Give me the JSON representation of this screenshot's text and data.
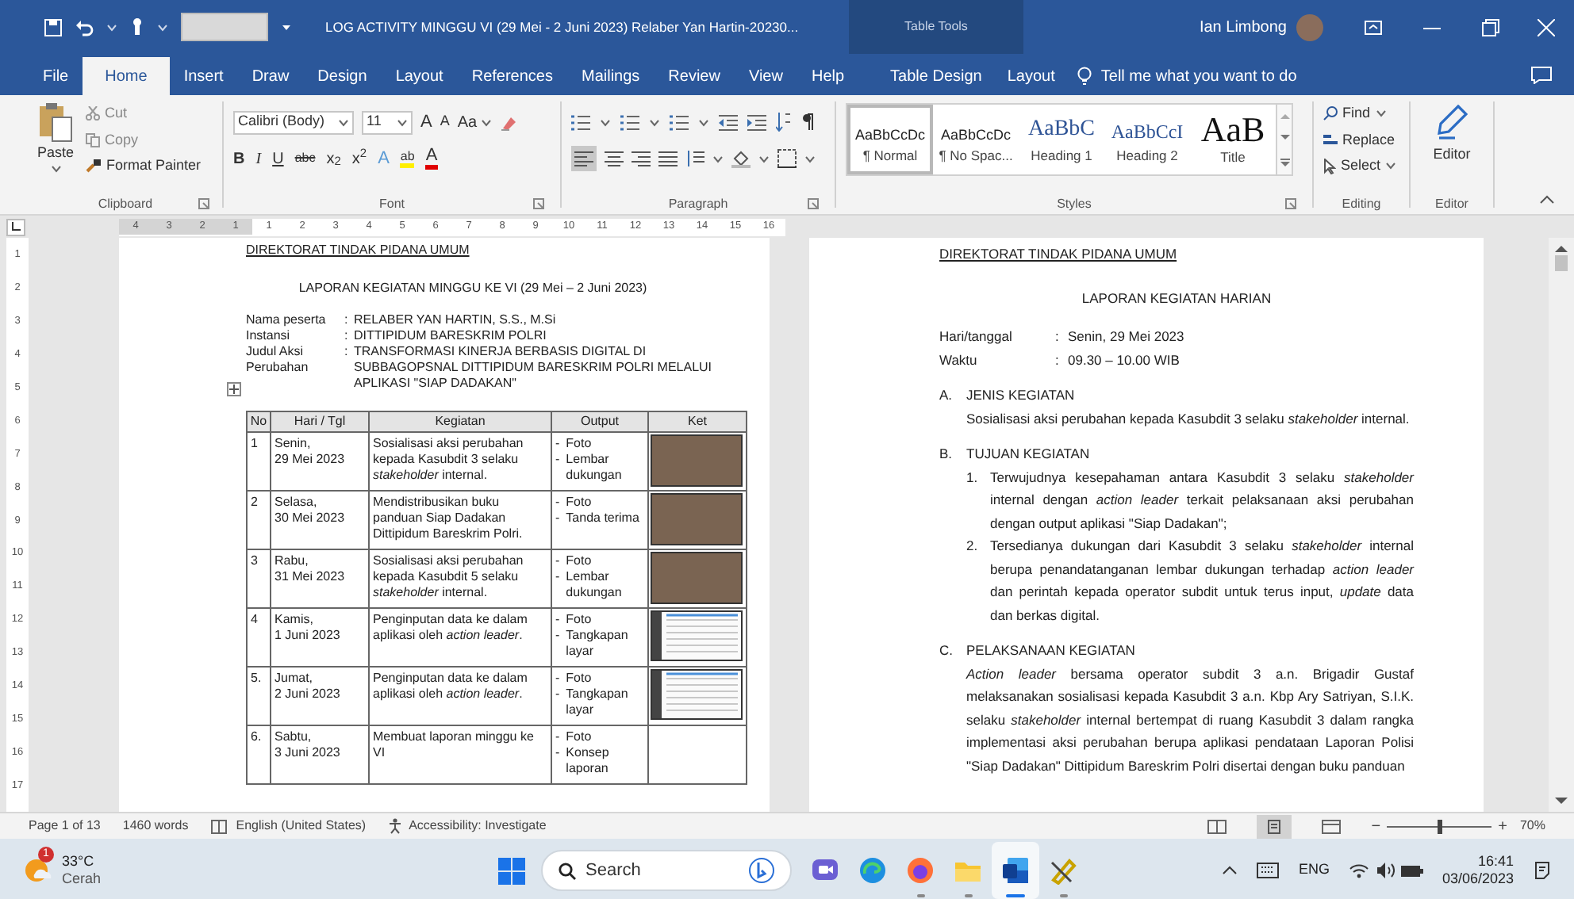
{
  "title_bar": {
    "title": "LOG ACTIVITY MINGGU VI (29 Mei - 2 Juni 2023) Relaber Yan Hartin-20230...",
    "context_label": "Table Tools",
    "user": "Ian Limbong"
  },
  "ribbon_tabs": [
    {
      "label": "File",
      "selected": false
    },
    {
      "label": "Home",
      "selected": true
    },
    {
      "label": "Insert",
      "selected": false
    },
    {
      "label": "Draw",
      "selected": false
    },
    {
      "label": "Design",
      "selected": false
    },
    {
      "label": "Layout",
      "selected": false
    },
    {
      "label": "References",
      "selected": false
    },
    {
      "label": "Mailings",
      "selected": false
    },
    {
      "label": "Review",
      "selected": false
    },
    {
      "label": "View",
      "selected": false
    },
    {
      "label": "Help",
      "selected": false
    }
  ],
  "context_tabs": [
    {
      "label": "Table Design",
      "selected": false
    },
    {
      "label": "Layout",
      "selected": false
    }
  ],
  "tell_me": {
    "placeholder": "Tell me what you want to do"
  },
  "clipboard": {
    "paste": "Paste",
    "cut": "Cut",
    "copy": "Copy",
    "format_painter": "Format Painter",
    "label": "Clipboard"
  },
  "font": {
    "font_name": "Calibri (Body)",
    "font_size": "11",
    "grow": "A",
    "shrink": "A",
    "change_case": "Aa",
    "format_buttons": [
      "B",
      "I",
      "U",
      "abc",
      "x$_{2}$",
      "x$^{2}$"
    ],
    "effects": "A",
    "highlight": "ab",
    "font_color": "A",
    "label": "Font"
  },
  "paragraph": {
    "label": "Paragraph"
  },
  "styles": {
    "label": "Styles",
    "items": [
      {
        "preview": "AaBbCcDc",
        "name": "¶ Normal",
        "kind": "body",
        "selected": true
      },
      {
        "preview": "AaBbCcDc",
        "name": "¶ No Spac...",
        "kind": "body",
        "selected": false
      },
      {
        "preview": "AaBbC",
        "name": "Heading 1",
        "kind": "heading1",
        "selected": false
      },
      {
        "preview": "AaBbCcI",
        "name": "Heading 2",
        "kind": "heading2",
        "selected": false
      },
      {
        "preview": "AaB",
        "name": "Title",
        "kind": "title",
        "selected": false
      }
    ]
  },
  "editing": {
    "find": "Find",
    "replace": "Replace",
    "select": "Select",
    "label": "Editing"
  },
  "editor": {
    "button": "Editor",
    "label": "Editor"
  },
  "ruler": {
    "horizontal": [
      "4",
      "3",
      "2",
      "1",
      "1",
      "2",
      "3",
      "4",
      "5",
      "6",
      "7",
      "8",
      "9",
      "10",
      "11",
      "12",
      "13",
      "14",
      "15",
      "16"
    ],
    "vertical": [
      "1",
      "2",
      "3",
      "4",
      "5",
      "6",
      "7",
      "8",
      "9",
      "10",
      "11",
      "12",
      "13",
      "14",
      "15",
      "16",
      "17"
    ]
  },
  "left_page": {
    "header": "DIREKTORAT TINDAK PIDANA UMUM",
    "title": "LAPORAN KEGIATAN MINGGU KE VI (29 Mei – 2 Juni 2023)",
    "info": [
      {
        "label": "Nama peserta",
        "separator": ":",
        "value": "RELABER YAN HARTIN, S.S., M.Si"
      },
      {
        "label": "Instansi",
        "separator": ":",
        "value": "DITTIPIDUM BARESKRIM POLRI"
      },
      {
        "label": "Judul Aksi Perubahan",
        "separator": ":",
        "value": "TRANSFORMASI KINERJA BERBASIS DIGITAL DI SUBBAGOPSNAL DITTIPIDUM BARESKRIM POLRI MELALUI APLIKASI \"SIAP DADAKAN\""
      }
    ],
    "table": {
      "columns": [
        "No",
        "Hari / Tgl",
        "Kegiatan",
        "Output",
        "Ket"
      ],
      "rows": [
        {
          "no": "1",
          "day": "Senin,",
          "date": "29 Mei 2023",
          "activity": "Sosialisasi aksi perubahan kepada Kasubdit 3 selaku *stakeholder* internal.",
          "outputs": [
            {
              "marker": "-",
              "text": "Foto"
            },
            {
              "marker": "-",
              "text": "Lembar dukungan"
            }
          ],
          "kind": "photo"
        },
        {
          "no": "2",
          "day": "Selasa,",
          "date": "30 Mei 2023",
          "activity": "Mendistribusikan buku panduan Siap Dadakan Dittipidum Bareskrim Polri.",
          "outputs": [
            {
              "marker": "-",
              "text": "Foto"
            },
            {
              "marker": "-",
              "text": "Tanda terima"
            }
          ],
          "kind": "photo"
        },
        {
          "no": "3",
          "day": "Rabu,",
          "date": "31 Mei 2023",
          "activity": "Sosialisasi aksi perubahan kepada Kasubdit 5 selaku *stakeholder* internal.",
          "outputs": [
            {
              "marker": "-",
              "text": "Foto"
            },
            {
              "marker": "-",
              "text": "Lembar dukungan"
            }
          ],
          "kind": "photo"
        },
        {
          "no": "4",
          "day": "Kamis,",
          "date": "1 Juni 2023",
          "activity": "Penginputan data ke dalam aplikasi oleh *action leader*.",
          "outputs": [
            {
              "marker": "-",
              "text": "Foto"
            },
            {
              "marker": "-",
              "text": "Tangkapan layar"
            }
          ],
          "kind": "screenshot"
        },
        {
          "no": "5.",
          "day": "Jumat,",
          "date": "2 Juni 2023",
          "activity": "Penginputan data ke dalam aplikasi oleh *action leader*.",
          "outputs": [
            {
              "marker": "-",
              "text": "Foto"
            },
            {
              "marker": "-",
              "text": "Tangkapan layar"
            }
          ],
          "kind": "screenshot"
        },
        {
          "no": "6.",
          "day": "Sabtu,",
          "date": "3 Juni 2023",
          "activity": "Membuat laporan minggu ke VI",
          "outputs": [
            {
              "marker": "-",
              "text": "Foto"
            },
            {
              "marker": "-",
              "text": "Konsep laporan"
            }
          ],
          "kind": "none"
        }
      ]
    }
  },
  "right_page": {
    "header": "DIREKTORAT TINDAK PIDANA UMUM",
    "title": "LAPORAN KEGIATAN HARIAN",
    "fields": [
      {
        "label": "Hari/tanggal",
        "separator": ":",
        "value": "Senin, 29 Mei 2023"
      },
      {
        "label": "Waktu",
        "separator": ":",
        "value": "09.30 – 10.00 WIB"
      }
    ],
    "sections": [
      {
        "letter": "A.",
        "heading": "JENIS KEGIATAN",
        "paragraph": "Sosialisasi aksi perubahan kepada Kasubdit 3 selaku *stakeholder* internal."
      },
      {
        "letter": "B.",
        "heading": "TUJUAN KEGIATAN",
        "items": [
          {
            "number": "1.",
            "text": "Terwujudnya kesepahaman antara Kasubdit 3 selaku *stakeholder* internal dengan *action leader* terkait pelaksanaan aksi perubahan dengan output aplikasi \"Siap Dadakan\";"
          },
          {
            "number": "2.",
            "text": "Tersedianya dukungan dari Kasubdit 3 selaku *stakeholder* internal berupa penandatanganan lembar dukungan terhadap *action leader* dan perintah kepada operator subdit untuk terus input, *update* data dan berkas digital."
          }
        ]
      },
      {
        "letter": "C.",
        "heading": "PELAKSANAAN KEGIATAN",
        "paragraph": "*Action leader* bersama operator subdit 3 a.n. Brigadir Gustaf melaksanakan sosialisasi kepada Kasubdit 3 a.n. Kbp Ary Satriyan, S.I.K. selaku *stakeholder* internal bertempat di ruang Kasubdit 3 dalam rangka implementasi aksi perubahan berupa aplikasi pendataan Laporan Polisi \"Siap Dadakan\" Dittipidum Bareskrim Polri disertai dengan buku panduan"
      }
    ]
  },
  "status_bar": {
    "page": "Page 1 of 13",
    "words": "1460 words",
    "language": "English (United States)",
    "accessibility": "Accessibility: Investigate",
    "views": [
      {
        "kind": "read",
        "selected": false
      },
      {
        "kind": "print",
        "selected": true
      },
      {
        "kind": "web",
        "selected": false
      }
    ],
    "zoom_out": "−",
    "zoom_in": "+",
    "zoom": {
      "level": 0.5
    },
    "zoom_label": "70%"
  },
  "taskbar": {
    "weather": {
      "temperature": "33°C",
      "condition": "Cerah",
      "badge": "1"
    },
    "search": {
      "placeholder": "Search"
    },
    "apps": [
      {
        "kind": "chat",
        "running": false,
        "active": false
      },
      {
        "kind": "edge",
        "running": false,
        "active": false
      },
      {
        "kind": "firefox",
        "running": true,
        "active": false
      },
      {
        "kind": "explorer",
        "running": true,
        "active": false
      },
      {
        "kind": "word",
        "running": true,
        "active": true
      },
      {
        "kind": "tool",
        "running": true,
        "active": false
      }
    ],
    "language": "ENG",
    "time": "16:41",
    "date": "03/06/2023"
  }
}
